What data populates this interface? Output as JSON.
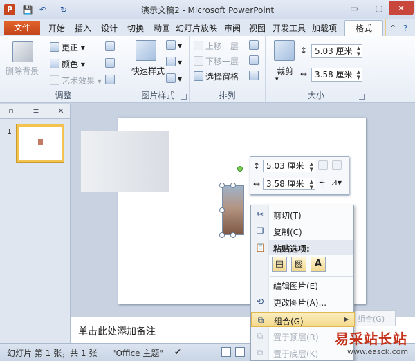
{
  "window": {
    "title": "演示文稿2 - Microsoft PowerPoint",
    "app_icon": "P",
    "min": "▭",
    "max": "▢",
    "close": "✕"
  },
  "quick_access": {
    "save": "💾",
    "undo": "↶",
    "redo": "↻"
  },
  "tabs": {
    "file": "文件",
    "items": [
      "开始",
      "插入",
      "设计",
      "切换",
      "动画",
      "幻灯片放映",
      "审阅",
      "视图",
      "开发工具",
      "加载项",
      "格式"
    ],
    "help": "⌃"
  },
  "ribbon": {
    "adjust": {
      "label": "调整",
      "remove_bg": "删除背景",
      "corrections": "更正",
      "color": "颜色",
      "artistic": "艺术效果"
    },
    "picture_styles": {
      "label": "图片样式",
      "quick_styles": "快速样式"
    },
    "arrange": {
      "label": "排列",
      "bring_forward": "上移一层",
      "send_backward": "下移一层",
      "selection_pane": "选择窗格"
    },
    "size": {
      "label": "大小",
      "crop": "裁剪",
      "height": "5.03 厘米",
      "width": "3.58 厘米"
    }
  },
  "slide_panel": {
    "slide_number": "1"
  },
  "mini_toolbar": {
    "height": "5.03 厘米",
    "width": "3.58 厘米"
  },
  "notes": {
    "placeholder": "单击此处添加备注"
  },
  "context_menu": {
    "cut": "剪切(T)",
    "copy": "复制(C)",
    "paste_header": "粘贴选项:",
    "paste_text_option": "A",
    "edit_picture": "编辑图片(E)",
    "change_picture": "更改图片(A)...",
    "group": "组合(G)",
    "bring_to_front": "置于顶层(R)",
    "send_to_back": "置于底层(K)",
    "submenu_peek": "组合(G)"
  },
  "status": {
    "slide_info": "幻灯片 第 1 张，共 1 张",
    "theme": "\"Office 主题\""
  },
  "watermark": {
    "title": "易采站长站",
    "url": "www.easck.com"
  }
}
